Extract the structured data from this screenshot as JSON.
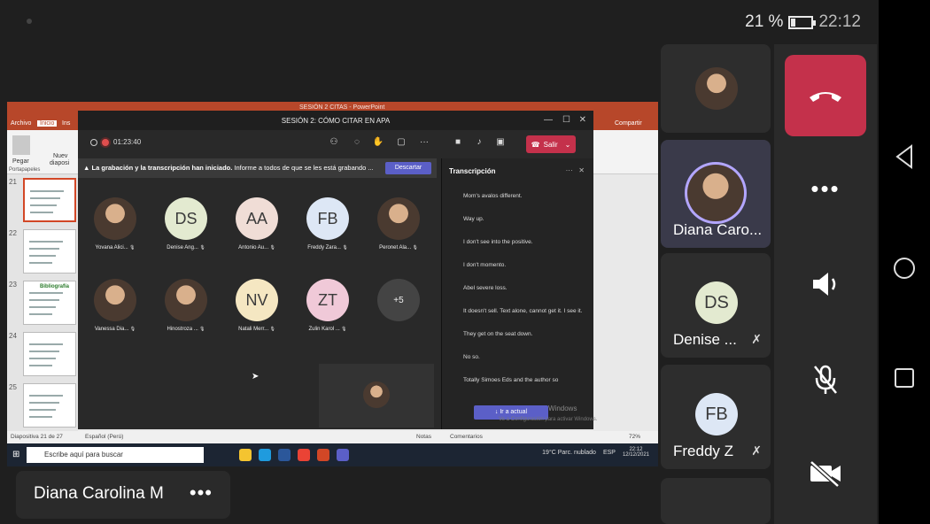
{
  "status_bar": {
    "battery_percent": "21 %",
    "battery_level": 0.21,
    "time": "22:12"
  },
  "powerpoint": {
    "title": "SESIÓN 2 CITAS  -  PowerPoint",
    "tabs": [
      "Archivo",
      "Inicio",
      "Ins"
    ],
    "ribbon": {
      "paste": "Pegar",
      "new": "Nuev",
      "new_sub": "diaposi",
      "clipboard": "Portapapeles",
      "share": "Compartir"
    },
    "thumbnails": [
      "21",
      "22",
      "23",
      "24",
      "25"
    ],
    "thumbnail_heading": "Bibliografía",
    "status": {
      "slide": "Diapositiva 21 de 27",
      "language": "Español (Perú)",
      "notes": "Notas",
      "comments": "Comentarios",
      "zoom": "72%"
    }
  },
  "windows_taskbar": {
    "search_placeholder": "Escribe aquí para buscar",
    "weather": "19°C  Parc. nublado",
    "lang": "ESP",
    "time": "22:12",
    "date": "12/12/2021"
  },
  "teams_window": {
    "title": "SESIÓN 2: CÓMO CITAR EN APA",
    "timer": "01:23:40",
    "leave_label": "Salir",
    "banner_bold": "La grabación y la transcripción han iniciado.",
    "banner_text": "Informe a todos de que se les está grabando ...",
    "dismiss_label": "Descartar",
    "participants": [
      {
        "name": "Yovana Alici...",
        "initials": "",
        "color": "#8a9aa8",
        "photo": true
      },
      {
        "name": "Denise Ang...",
        "initials": "DS",
        "color": "#e3ead0"
      },
      {
        "name": "Antonio Au...",
        "initials": "AA",
        "color": "#f0ddd6"
      },
      {
        "name": "Freddy Zara...",
        "initials": "FB",
        "color": "#dde7f5"
      },
      {
        "name": "Peronet Ala...",
        "initials": "",
        "color": "#cfa58a",
        "photo": true
      },
      {
        "name": "Vanessa Dia...",
        "initials": "",
        "color": "#e9e4e6",
        "photo": true
      },
      {
        "name": "Hinostroza ...",
        "initials": "",
        "color": "#b89a86",
        "photo": true
      },
      {
        "name": "Natali Merr...",
        "initials": "NV",
        "color": "#f5e7c2"
      },
      {
        "name": "Zulin Karol ...",
        "initials": "ZT",
        "color": "#f0c9d8"
      },
      {
        "name": "",
        "initials": "+5",
        "color": "#444444"
      }
    ],
    "transcript": {
      "title": "Transcripción",
      "lines": [
        "Mom's avalos different.",
        "Way up.",
        "I don't see into the positive.",
        "I don't momento.",
        "Abel severe loss.",
        "It doesn't sell. Text alone, cannot get it. I see it.",
        "They get on the seat down.",
        "No so.",
        "Totally Simoes Eds and the author so"
      ],
      "jump_label": "Ir a actual",
      "watermark": "Windows",
      "watermark_sub": "Ve a Configuración para activar Windows."
    }
  },
  "phone_participants": [
    {
      "name": "",
      "initials": "",
      "color": "#c7a38b",
      "photo": true
    },
    {
      "name": "Diana Caro...",
      "initials": "",
      "color": "#d9c2b8",
      "photo": true
    },
    {
      "name": "Denise ...",
      "initials": "DS",
      "color": "#e3ead0"
    },
    {
      "name": "Freddy Z",
      "initials": "FB",
      "color": "#dde7f5"
    }
  ],
  "local_user": {
    "name": "Diana Carolina M",
    "more": "•••"
  },
  "controls": [
    "hang-up",
    "more",
    "speaker",
    "mic-off",
    "camera-off"
  ]
}
